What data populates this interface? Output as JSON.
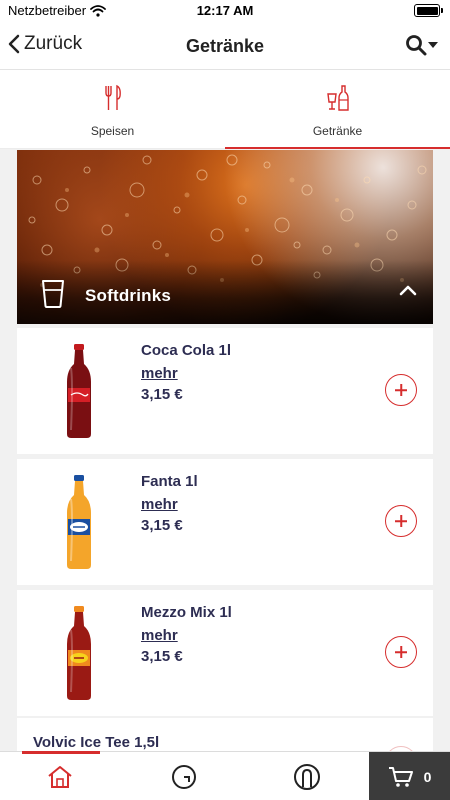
{
  "status_bar": {
    "carrier": "Netzbetreiber",
    "time": "12:17 AM"
  },
  "nav": {
    "back_label": "Zurück",
    "title": "Getränke",
    "search_icon": "search-icon"
  },
  "tabs": [
    {
      "label": "Speisen",
      "icon": "cutlery-icon",
      "active": false
    },
    {
      "label": "Getränke",
      "icon": "drinks-icon",
      "active": true
    }
  ],
  "category": {
    "title": "Softdrinks",
    "icon": "cup-icon",
    "expanded": true
  },
  "products": [
    {
      "name": "Coca Cola 1l",
      "more": "mehr",
      "price": "3,15 €",
      "bottle_color": "#b3161c",
      "label_color": "#d51f26"
    },
    {
      "name": "Fanta 1l",
      "more": "mehr",
      "price": "3,15 €",
      "bottle_color": "#f4a52a",
      "label_color": "#1a4fa0"
    },
    {
      "name": "Mezzo Mix 1l",
      "more": "mehr",
      "price": "3,15 €",
      "bottle_color": "#9a1a14",
      "label_color": "#f08a1e"
    }
  ],
  "partial_product": {
    "name": "Volvic Ice Tee 1,5l"
  },
  "bottom_bar": {
    "cart_count": "0"
  },
  "colors": {
    "accent": "#d62d2d",
    "text_dark": "#2d2d52",
    "cart_bg": "#3b3b3b"
  }
}
